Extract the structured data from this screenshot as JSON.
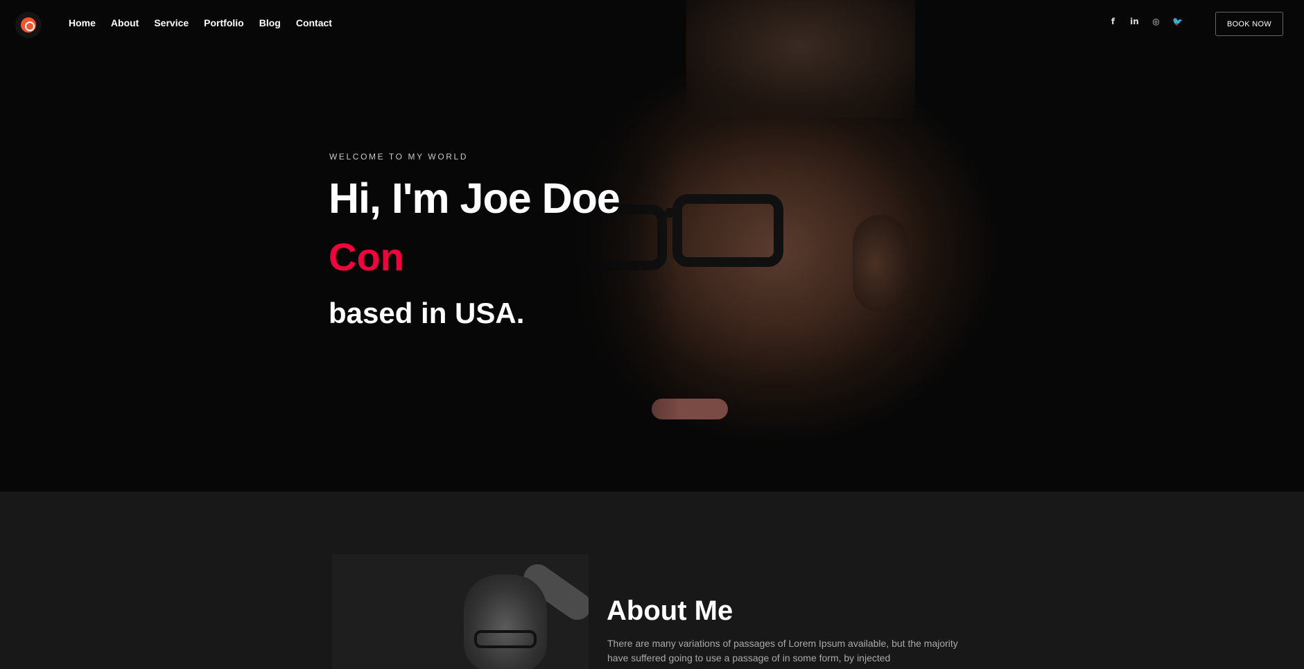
{
  "nav": {
    "menu": [
      "Home",
      "About",
      "Service",
      "Portfolio",
      "Blog",
      "Contact"
    ],
    "socials": [
      {
        "icon": "facebook-icon",
        "glyph": "f"
      },
      {
        "icon": "linkedin-icon",
        "glyph": "in"
      },
      {
        "icon": "instagram-icon",
        "glyph": "◎"
      },
      {
        "icon": "twitter-icon",
        "glyph": "🐦"
      }
    ],
    "book_label": "BOOK NOW"
  },
  "hero": {
    "kicker": "WELCOME TO MY WORLD",
    "title": "Hi, I'm Joe Doe",
    "role": "Con",
    "location": "based in USA."
  },
  "about": {
    "title": "About Me",
    "text": "There are many variations of passages of Lorem Ipsum available, but the majority have suffered going to use a passage of in some form, by injected"
  },
  "colors": {
    "accent": "#f5003d",
    "hero_bg": "#070707",
    "about_bg": "#181818"
  }
}
